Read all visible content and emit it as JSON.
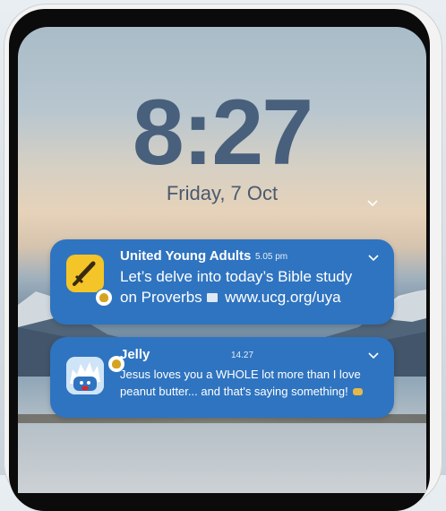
{
  "lockscreen": {
    "time": "8:27",
    "date": "Friday, 7 Oct",
    "chevron_icon": "chevron-down-icon"
  },
  "notifications": [
    {
      "app": "United Young Adults",
      "time": "5.05 pm",
      "body": "Let’s delve into today’s Bible study on Proverbs",
      "body_suffix": "www.ucg.org/uya",
      "icon": "sword-icon",
      "badge_icon": "bell-icon",
      "icon_color": "#f3c528"
    },
    {
      "app": "Jelly",
      "time": "14.27",
      "body": "Jesus loves you a WHOLE lot more than I love peanut butter... and that's saying something!",
      "icon": "jelly-character-icon",
      "badge_icon": "bell-icon",
      "icon_color": "#ffffff"
    }
  ],
  "colors": {
    "notification_bg": "#2f74c0",
    "clock": "#48607c"
  }
}
